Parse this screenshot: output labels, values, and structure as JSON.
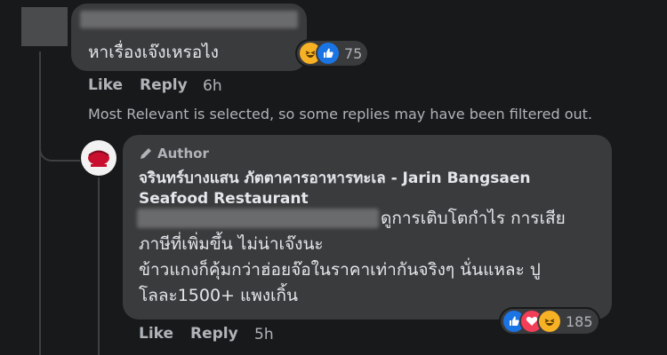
{
  "comment1": {
    "text": "หาเรื่องเจ๊งเหรอไง",
    "reaction_icons": [
      "haha-icon",
      "like-icon"
    ],
    "reaction_count": "75",
    "actions": {
      "like": "Like",
      "reply": "Reply"
    },
    "time": "6h"
  },
  "filter_notice": "Most Relevant is selected, so some replies may have been filtered out.",
  "reply": {
    "author_badge": "Author",
    "author_name_line1": "จรินทร์บางแสน ภัตตาคารอาหารทะเล - Jarin Bangsaen",
    "author_name_line2": "Seafood Restaurant",
    "text_line1": "ดูการเติบโตกำไร การเสีย",
    "text_line2": "ภาษีที่เพิ่มขึ้น ไม่น่าเจ๊งนะ",
    "text_line3": "ข้าวแกงก็คุ้มกว่าฮ่อยจ๊อในราคาเท่ากันจริงๆ นั่นแหละ ปู",
    "text_line4": "โลละ1500+ แพงเกิ้น",
    "reaction_icons": [
      "like-icon",
      "love-icon",
      "haha-icon"
    ],
    "reaction_count": "185",
    "actions": {
      "like": "Like",
      "reply": "Reply"
    },
    "time": "5h"
  },
  "colors": {
    "background": "#18191a",
    "bubble": "#3a3b3c",
    "secondary_text": "#b0b3b8",
    "like_blue": "#1b74e4",
    "love_red": "#f33e58",
    "haha_yellow": "#f7b125"
  }
}
